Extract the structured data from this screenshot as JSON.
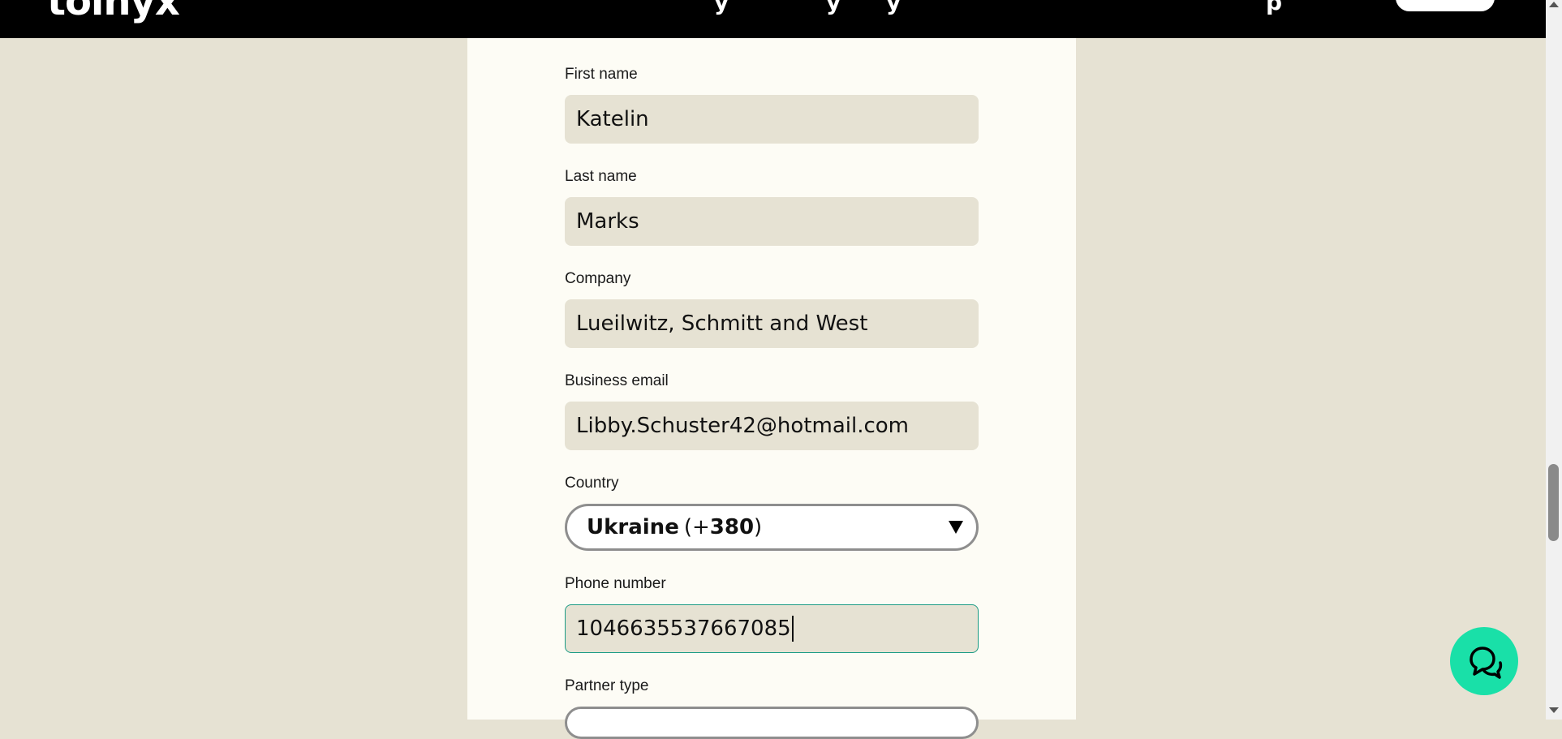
{
  "header": {
    "logo_text": "tolnyx",
    "nav_fragments": [
      "y",
      "y",
      "y"
    ],
    "nav_fragment_right": "p"
  },
  "form": {
    "first_name": {
      "label": "First name",
      "value": "Katelin"
    },
    "last_name": {
      "label": "Last name",
      "value": "Marks"
    },
    "company": {
      "label": "Company",
      "value": "Lueilwitz, Schmitt and West"
    },
    "business_email": {
      "label": "Business email",
      "value": "Libby.Schuster42@hotmail.com"
    },
    "country": {
      "label": "Country",
      "selected_name": "Ukraine",
      "code_prefix": "(+",
      "code_number": "380",
      "code_suffix": ")"
    },
    "phone_number": {
      "label": "Phone number",
      "value": "1046635537667085"
    },
    "partner_type": {
      "label": "Partner type"
    }
  },
  "colors": {
    "page_background": "#e6e2d3",
    "panel_background": "#fdfcf5",
    "input_background": "#e6e2d3",
    "focus_border": "#1a9b84",
    "chat_button": "#19e0a8",
    "header_background": "#000000"
  },
  "icons": {
    "chat": "chat-bubbles-icon",
    "dropdown": "triangle-down-icon"
  }
}
